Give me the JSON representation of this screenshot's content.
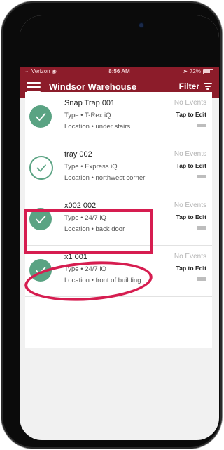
{
  "status_bar": {
    "carrier": "Verizon",
    "time": "8:56 AM",
    "battery": "72%"
  },
  "header": {
    "title": "Windsor Warehouse",
    "filter_label": "Filter"
  },
  "colors": {
    "brand": "#8c1c2a",
    "check": "#5aa383",
    "annotation": "#d61d50"
  },
  "devices": [
    {
      "name": "Snap Trap 001",
      "type": "Type • T-Rex iQ",
      "location": "Location • under stairs",
      "events": "No Events",
      "action": "Tap to Edit",
      "check_style": "filled"
    },
    {
      "name": "tray 002",
      "type": "Type • Express iQ",
      "location": "Location • northwest corner",
      "events": "No Events",
      "action": "Tap to Edit",
      "check_style": "outline"
    },
    {
      "name": "x002 002",
      "type": "Type • 24/7 iQ",
      "location": "Location • back door",
      "events": "No Events",
      "action": "Tap to Edit",
      "check_style": "filled"
    },
    {
      "name": "x1 001",
      "type": "Type • 24/7 iQ",
      "location": "Location • front of building",
      "events": "No Events",
      "action": "Tap to Edit",
      "check_style": "filled"
    }
  ]
}
